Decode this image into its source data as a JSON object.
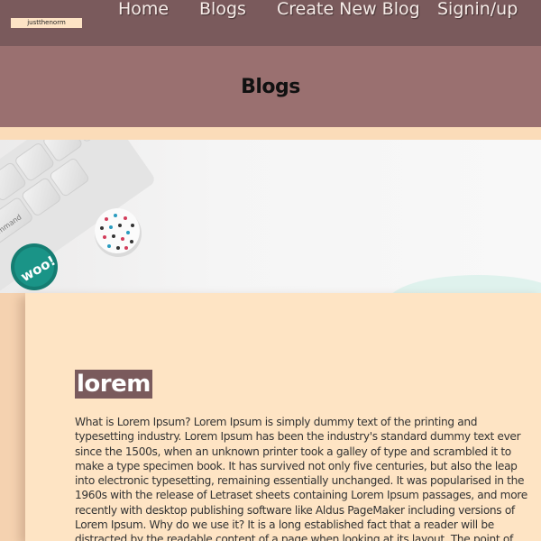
{
  "navbar": {
    "brand": "justthenorm",
    "links": [
      "Home",
      "Blogs",
      "Create New Blog",
      "Signin/up"
    ]
  },
  "header": {
    "title": "Blogs"
  },
  "post": {
    "title": "lorem",
    "body": "What is Lorem Ipsum? Lorem Ipsum is simply dummy text of the printing and typesetting industry. Lorem Ipsum has been the industry's standard dummy text ever since the 1500s, when an unknown printer took a galley of type and scrambled it to make a type specimen book. It has survived not only five centuries, but also the leap into electronic typesetting, remaining essentially unchanged. It was popularised in the 1960s with the release of Letraset sheets containing Lorem Ipsum passages, and more recently with desktop publishing software like Aldus PageMaker including versions of Lorem Ipsum. Why do we use it? It is a long established fact that a reader will be distracted by the readable content of a page when looking at its layout. The point of using Lorem Ipsum is that it has a more-or-less"
  },
  "hero": {
    "keyboard_key_label": "command",
    "badge_text": "woo!"
  },
  "colors": {
    "navbar": "#7a5a5c",
    "header_band": "#9a7070",
    "page_bg": "#fbdcb9",
    "card_bg": "#fee4c4",
    "title_highlight": "#7a5a5c"
  }
}
